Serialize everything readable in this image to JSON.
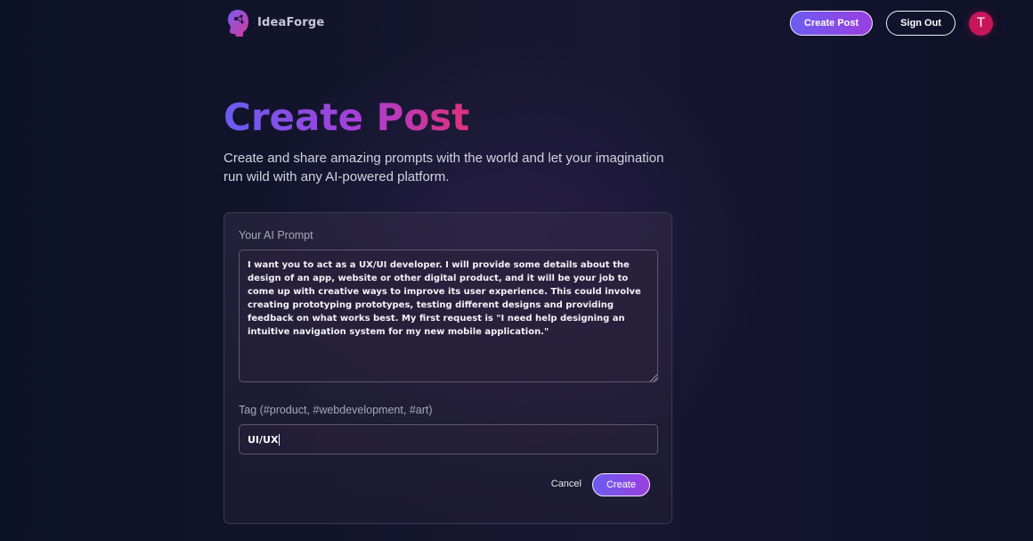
{
  "brand": {
    "name": "IdeaForge",
    "logo_icon": "ai-head-icon",
    "accent_colors": [
      "#6b5cf0",
      "#a63fd6",
      "#e0307a"
    ]
  },
  "nav": {
    "create_post_label": "Create Post",
    "sign_out_label": "Sign Out",
    "avatar_initial": "T",
    "avatar_color": "#c8155a"
  },
  "hero": {
    "title": "Create Post",
    "description": "Create and share amazing prompts with the world and let your imagination run wild with any AI-powered platform."
  },
  "form": {
    "prompt_label": "Your AI Prompt",
    "prompt_value": "I want you to act as a UX/UI developer. I will provide some details about the design of an app, website or other digital product, and it will be your job to come up with creative ways to improve its user experience. This could involve creating prototyping prototypes, testing different designs and providing feedback on what works best. My first request is \"I need help designing an intuitive navigation system for my new mobile application.\"",
    "tag_label": "Tag (#product, #webdevelopment, #art)",
    "tag_value": "UI/UX",
    "cancel_label": "Cancel",
    "submit_label": "Create"
  }
}
